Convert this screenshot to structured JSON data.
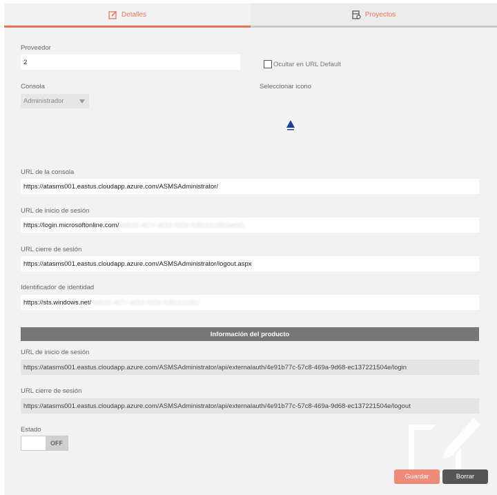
{
  "tabs": [
    {
      "label": "Detalles",
      "icon": "edit-icon",
      "active": true
    },
    {
      "label": "Proyectos",
      "icon": "projects-icon",
      "active": false
    }
  ],
  "provider": {
    "label": "Proveedor",
    "value": "2"
  },
  "hide_default": {
    "label": "Ocultar en URL Default",
    "checked": false
  },
  "console": {
    "label": "Consola",
    "value": "Administrador"
  },
  "icon_select": {
    "label": "Seleccionar icono",
    "icon": "azure-logo-icon"
  },
  "console_url": {
    "label": "URL de la consola",
    "value": "https://atasms001.eastus.cloudapp.azure.com/ASMSAdministrator/"
  },
  "login_url": {
    "label": "URL de inicio de sesión",
    "value_visible": "https://login.microsoftonline.com/",
    "value_obscured": "4e91f1-db7c-a014-932e-5d5c12c0f1/saml2"
  },
  "logout_url": {
    "label": "URL cierre de sesión",
    "value": "https://atasms001.eastus.cloudapp.azure.com/ASMSAdministrator/logout.aspx"
  },
  "identity": {
    "label": "Identificador de identidad",
    "value_visible": "https://sts.windows.net/",
    "value_obscured": "4e91f1-db7c-a014-932e-5d5c12c0f1/"
  },
  "product_info": {
    "title": "Información del producto",
    "login_label": "URL de inicio de sesión",
    "login_value": "https://atasms001.eastus.cloudapp.azure.com/ASMSAdministrator/api/externalauth/4e91b77c-57c8-469a-9d68-ec137221504e/login",
    "logout_label": "URL cierre de sesión",
    "logout_value": "https://atasms001.eastus.cloudapp.azure.com/ASMSAdministrator/api/externalauth/4e91b77c-57c8-469a-9d68-ec137221504e/logout"
  },
  "status": {
    "label": "Estado",
    "state": "OFF"
  },
  "buttons": {
    "save": "Guardar",
    "delete": "Borrar"
  },
  "colors": {
    "accent": "#e8735a",
    "save_button": "#ee8b76",
    "delete_button": "#555555",
    "section_bar": "#777777"
  }
}
